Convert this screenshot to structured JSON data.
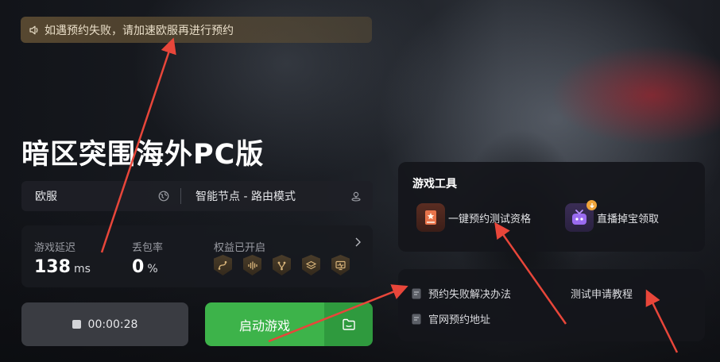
{
  "notice": {
    "icon": "speaker-icon",
    "text": "如遇预约失败，请加速欧服再进行预约"
  },
  "game": {
    "title": "暗区突围海外PC版"
  },
  "server_bar": {
    "region": "欧服",
    "region_icon": "globe-icon",
    "node": "智能节点 - 路由模式",
    "node_icon": "location-pin-icon"
  },
  "stats": {
    "latency_label": "游戏延迟",
    "latency_value": "138",
    "latency_unit": "ms",
    "loss_label": "丢包率",
    "loss_value": "0",
    "loss_unit": "%",
    "perks_label": "权益已开启",
    "perk_icons": [
      "route-icon",
      "audio-wave-icon",
      "branch-icon",
      "layers-icon",
      "monitor-pulse-icon"
    ]
  },
  "timer": {
    "value": "00:00:28"
  },
  "start": {
    "label": "启动游戏",
    "side_icon": "folder-icon"
  },
  "tools": {
    "title": "游戏工具",
    "items": [
      {
        "label": "一键预约测试资格",
        "icon": "book-icon"
      },
      {
        "label": "直播掉宝领取",
        "icon": "gift-tv-icon"
      }
    ]
  },
  "links": {
    "items": [
      {
        "label": "预约失败解决办法",
        "icon": "document-icon"
      },
      {
        "label": "官网预约地址",
        "icon": "document-icon"
      },
      {
        "label": "测试申请教程"
      }
    ]
  },
  "colors": {
    "accent_green": "#3db34a",
    "accent_green_dark": "#2f9a3e",
    "annotation_red": "#e8463a",
    "notice_bg": "#62503a"
  }
}
